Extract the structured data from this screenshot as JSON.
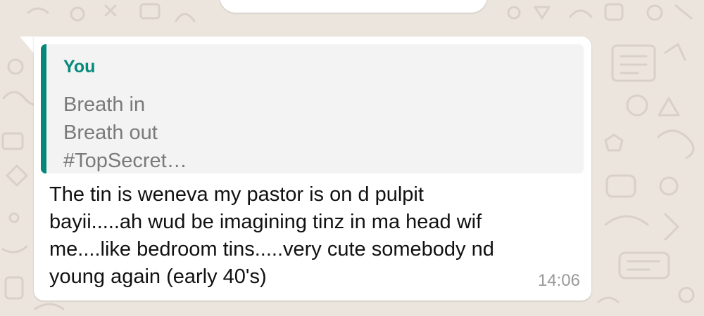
{
  "colors": {
    "wallpaper": "#ece5dd",
    "bubble": "#ffffff",
    "quote_background": "#f3f3f3",
    "quote_accent": "#06877a",
    "quote_author": "#068a7d",
    "quote_text": "#7a7a7a",
    "message_text": "#111111",
    "timestamp": "#9a9a9a"
  },
  "message": {
    "quoted": {
      "author": "You",
      "text": "Breath in\nBreath out\n#TopSecret…"
    },
    "text": "The tin is weneva my pastor is on d pulpit\nbayii.....ah wud be imagining tinz in ma head wif\nme....like bedroom tins.....very cute somebody nd\nyoung again (early 40's)",
    "time": "14:06"
  }
}
